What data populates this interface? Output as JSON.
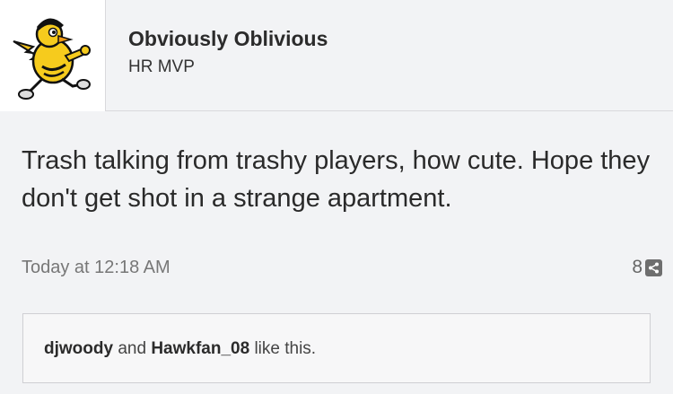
{
  "post": {
    "author": {
      "name": "Obviously Oblivious",
      "title": "HR MVP"
    },
    "message": "Trash talking from trashy players, how cute. Hope they don't get shot in a strange apartment.",
    "timestamp": "Today at 12:18 AM",
    "share_count": "8",
    "likes": {
      "users": [
        "djwoody",
        "Hawkfan_08"
      ],
      "conjunction": " and ",
      "suffix": " like this."
    }
  },
  "icons": {
    "share": "share-icon",
    "avatar": "hawkeye-mascot-avatar"
  }
}
